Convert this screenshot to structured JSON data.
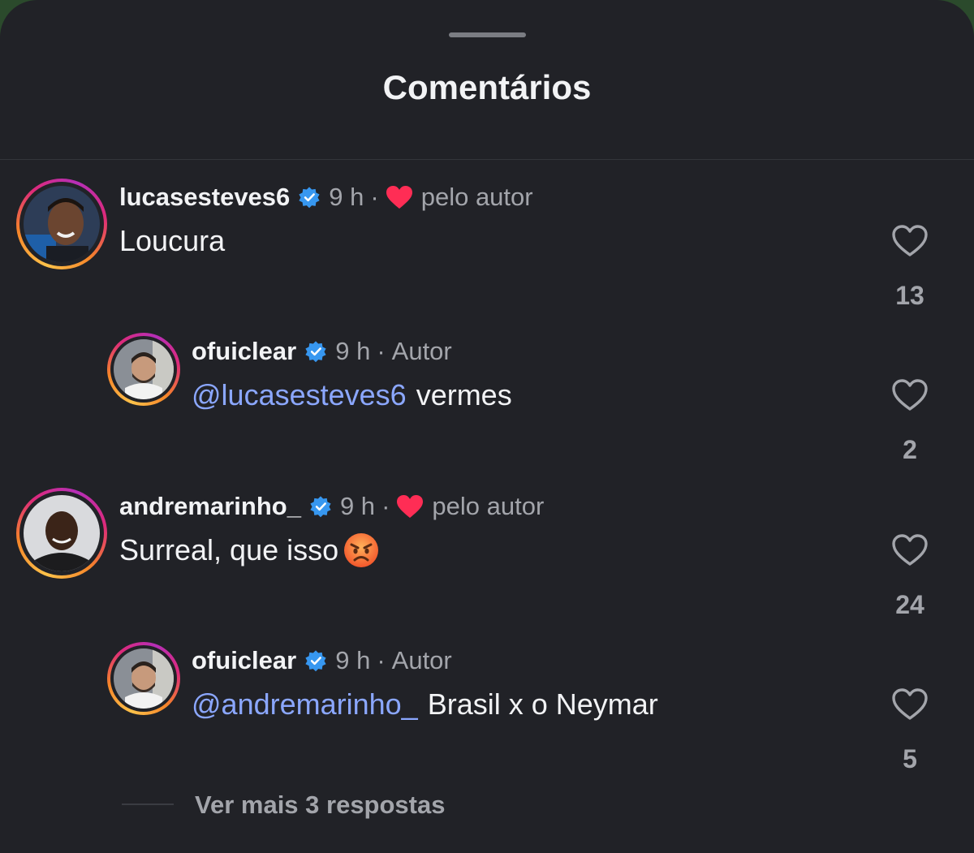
{
  "header": {
    "title": "Comentários"
  },
  "comments": [
    {
      "username": "lucasesteves6",
      "time": "9 h",
      "tag": "pelo autor",
      "text": "Loucura",
      "mention": "",
      "likes": "13",
      "liked_by_author": true,
      "is_reply": false
    },
    {
      "username": "ofuiclear",
      "time": "9 h",
      "tag": "Autor",
      "text": "vermes",
      "mention": "@lucasesteves6",
      "likes": "2",
      "liked_by_author": false,
      "is_reply": true
    },
    {
      "username": "andremarinho_",
      "time": "9 h",
      "tag": "pelo autor",
      "text": "Surreal, que isso",
      "mention": "",
      "likes": "24",
      "liked_by_author": true,
      "is_reply": false,
      "emoji": "angry-face"
    },
    {
      "username": "ofuiclear",
      "time": "9 h",
      "tag": "Autor",
      "text": "Brasil x o Neymar",
      "mention": "@andremarinho_",
      "likes": "5",
      "liked_by_author": false,
      "is_reply": true
    }
  ],
  "footer": {
    "more_replies": "Ver mais 3 respostas"
  },
  "colors": {
    "background": "#212227",
    "mention": "#8ba7ff",
    "verified": "#3797f0",
    "heart": "#ff2d55"
  },
  "icons": {
    "verified": "verified-badge-icon",
    "like": "heart-outline-icon",
    "liked_by_author": "heart-filled-icon"
  }
}
